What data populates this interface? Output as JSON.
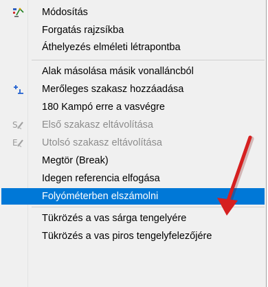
{
  "menu": {
    "items": [
      {
        "label": "Módosítás",
        "icon": "edit-shape-icon",
        "disabled": false
      },
      {
        "label": "Forgatás rajzsíkba",
        "icon": "",
        "disabled": false
      },
      {
        "label": "Áthelyezés elméleti létrapontba",
        "icon": "",
        "disabled": false
      },
      {
        "label": "Alak másolása másik vonalláncból",
        "icon": "",
        "disabled": false
      },
      {
        "label": "Merőleges szakasz hozzáadása",
        "icon": "add-perpendicular-segment-icon",
        "disabled": false
      },
      {
        "label": "180 Kampó erre a vasvégre",
        "icon": "",
        "disabled": false
      },
      {
        "label": "Első szakasz eltávolítása",
        "icon": "remove-first-segment-icon",
        "disabled": true
      },
      {
        "label": "Utolsó szakasz eltávolítása",
        "icon": "remove-last-segment-icon",
        "disabled": true
      },
      {
        "label": "Megtör (Break)",
        "icon": "",
        "disabled": false
      },
      {
        "label": "Idegen referencia elfogása",
        "icon": "",
        "disabled": false
      },
      {
        "label": "Folyóméterben elszámolni",
        "icon": "",
        "disabled": false,
        "selected": true
      },
      {
        "label": "Tükrözés a vas sárga tengelyére",
        "icon": "",
        "disabled": false
      },
      {
        "label": "Tükrözés a vas piros tengelyfelezőjére",
        "icon": "",
        "disabled": false
      }
    ]
  },
  "colors": {
    "menu_background": "#f0f0f0",
    "selection": "#0078d7",
    "disabled_text": "#8c8c8c",
    "annotation_arrow": "#d62020"
  }
}
